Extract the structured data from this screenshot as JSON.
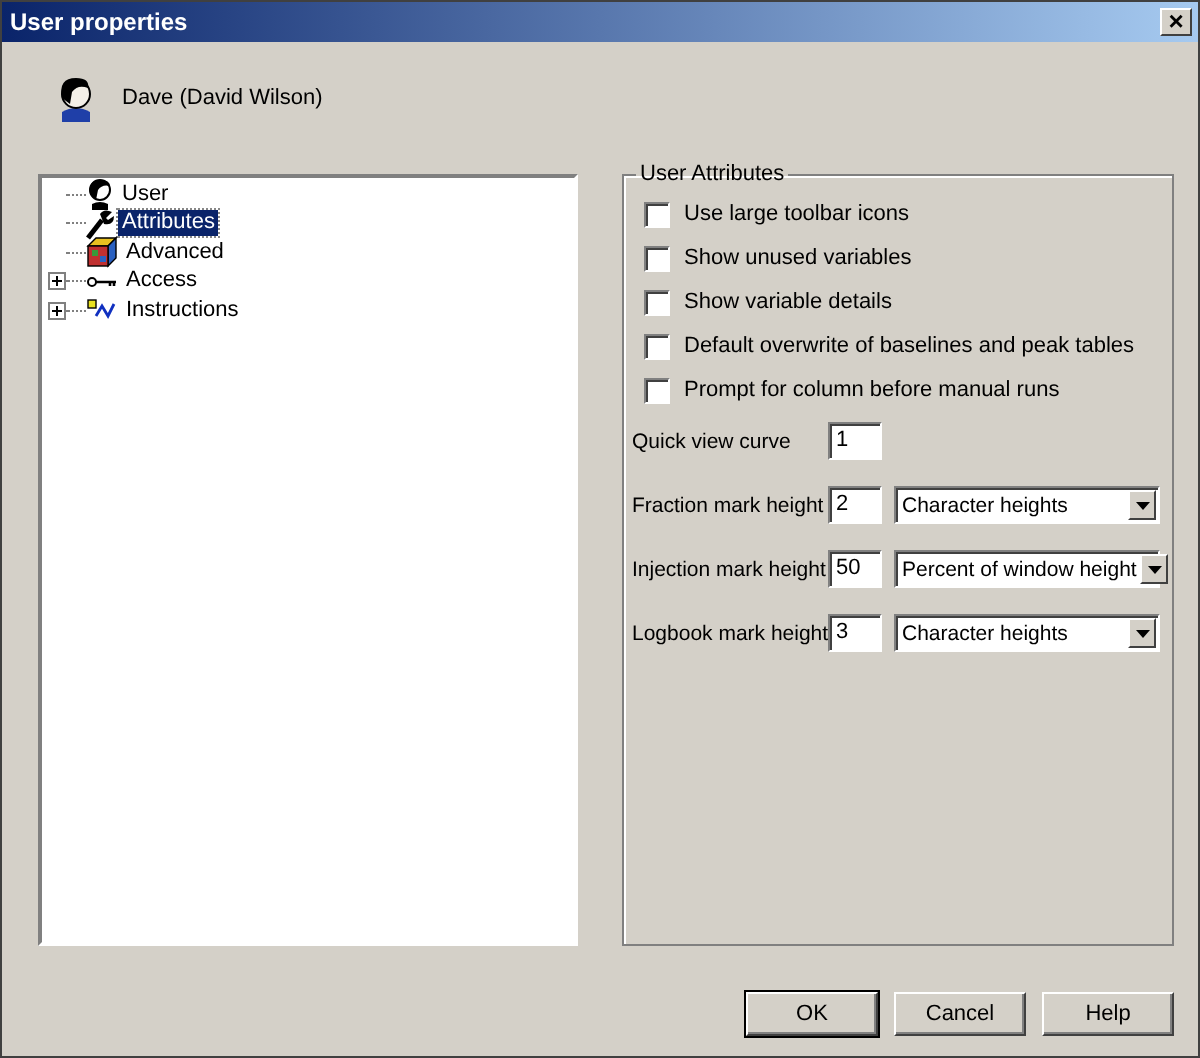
{
  "window": {
    "title": "User properties",
    "close": "×"
  },
  "user": {
    "name": "Dave (David Wilson)"
  },
  "tree": [
    {
      "label": "User",
      "selected": false
    },
    {
      "label": "Attributes",
      "selected": true
    },
    {
      "label": "Advanced",
      "selected": false
    },
    {
      "label": "Access",
      "selected": false,
      "expanded": false
    },
    {
      "label": "Instructions",
      "selected": false,
      "expanded": false
    }
  ],
  "group": {
    "title": "User  Attributes"
  },
  "checkboxes": [
    {
      "label": "Use large toolbar icons",
      "checked": false
    },
    {
      "label": "Show unused variables",
      "checked": false
    },
    {
      "label": "Show variable details",
      "checked": false
    },
    {
      "label": "Default overwrite of baselines and peak tables",
      "checked": false
    },
    {
      "label": "Prompt for column before manual runs",
      "checked": false
    }
  ],
  "fields": [
    {
      "label": "Quick view curve",
      "value": "1"
    },
    {
      "label": "Fraction mark height",
      "value": "2",
      "unit": "Character heights"
    },
    {
      "label": "Injection mark height",
      "value": "50",
      "unit": "Percent of window height"
    },
    {
      "label": "Logbook mark height",
      "value": "3",
      "unit": "Character heights"
    }
  ],
  "buttons": [
    {
      "label": "OK",
      "default": true
    },
    {
      "label": "Cancel",
      "default": false
    },
    {
      "label": "Help",
      "default": false
    }
  ]
}
